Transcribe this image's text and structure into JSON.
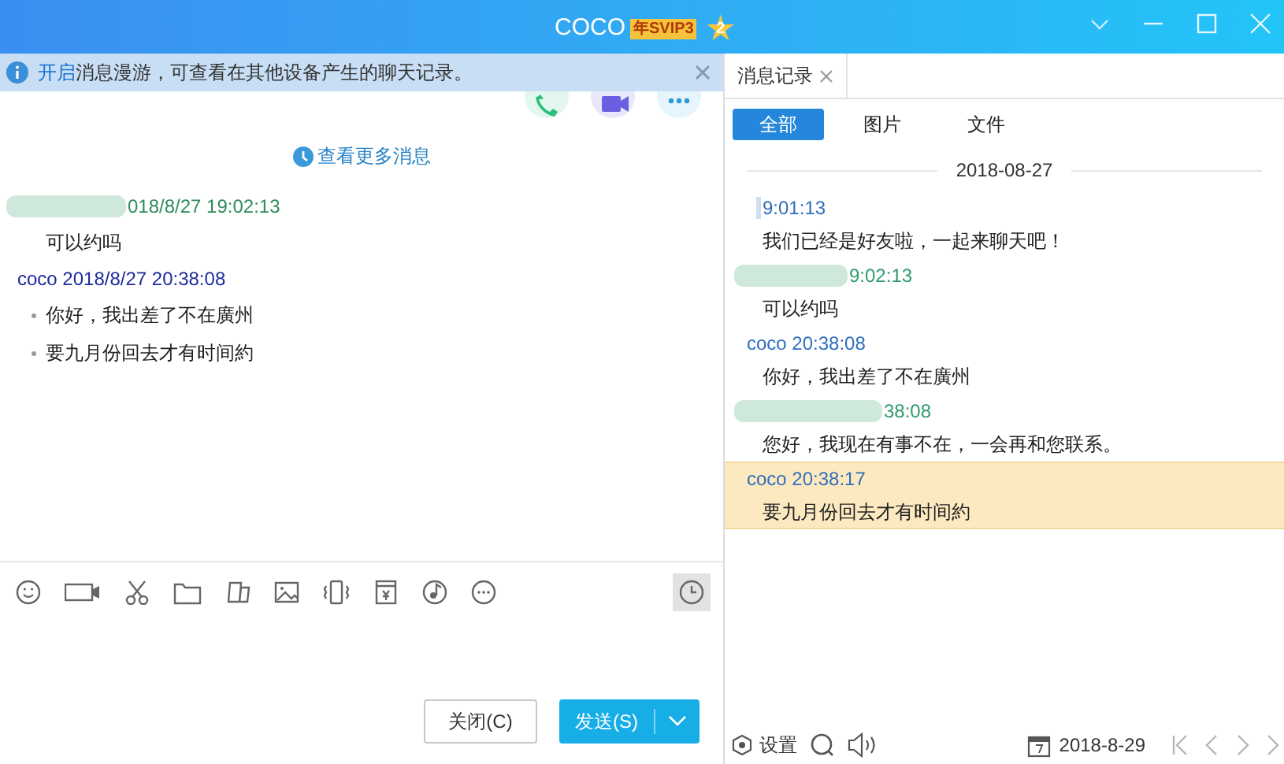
{
  "window": {
    "title": "COCO",
    "vip_badge": "年SVIP3",
    "level_badge": "2"
  },
  "notice": {
    "link": "开启",
    "text": "消息漫游，可查看在其他设备产生的聊天记录。"
  },
  "more_messages": "查看更多消息",
  "chat": [
    {
      "kind": "friend",
      "header": "018/8/27 19:02:13",
      "lines": [
        "可以约吗"
      ]
    },
    {
      "kind": "self",
      "header": "coco 2018/8/27 20:38:08",
      "lines": [
        "你好，我出差了不在廣州",
        "要九月份回去才有时间約"
      ]
    }
  ],
  "buttons": {
    "close": "关闭(C)",
    "send": "发送(S)"
  },
  "history": {
    "tab": "消息记录",
    "filters": [
      {
        "label": "全部",
        "selected": true
      },
      {
        "label": "图片",
        "selected": false
      },
      {
        "label": "文件",
        "selected": false
      }
    ],
    "date": "2018-08-27",
    "messages": [
      {
        "kind": "friend_blue",
        "header": "9:01:13",
        "text": "我们已经是好友啦，一起来聊天吧！",
        "selected": false
      },
      {
        "kind": "friend",
        "header": "9:02:13",
        "text": "可以约吗",
        "selected": false
      },
      {
        "kind": "self",
        "header": "coco 20:38:08",
        "text": "你好，我出差了不在廣州",
        "selected": false
      },
      {
        "kind": "friend",
        "header": "38:08",
        "text": "您好，我现在有事不在，一会再和您联系。",
        "selected": false
      },
      {
        "kind": "self",
        "header": "coco 20:38:17",
        "text": "要九月份回去才有时间約",
        "selected": true
      }
    ],
    "settings": "设置",
    "current_date": "2018-8-29"
  }
}
